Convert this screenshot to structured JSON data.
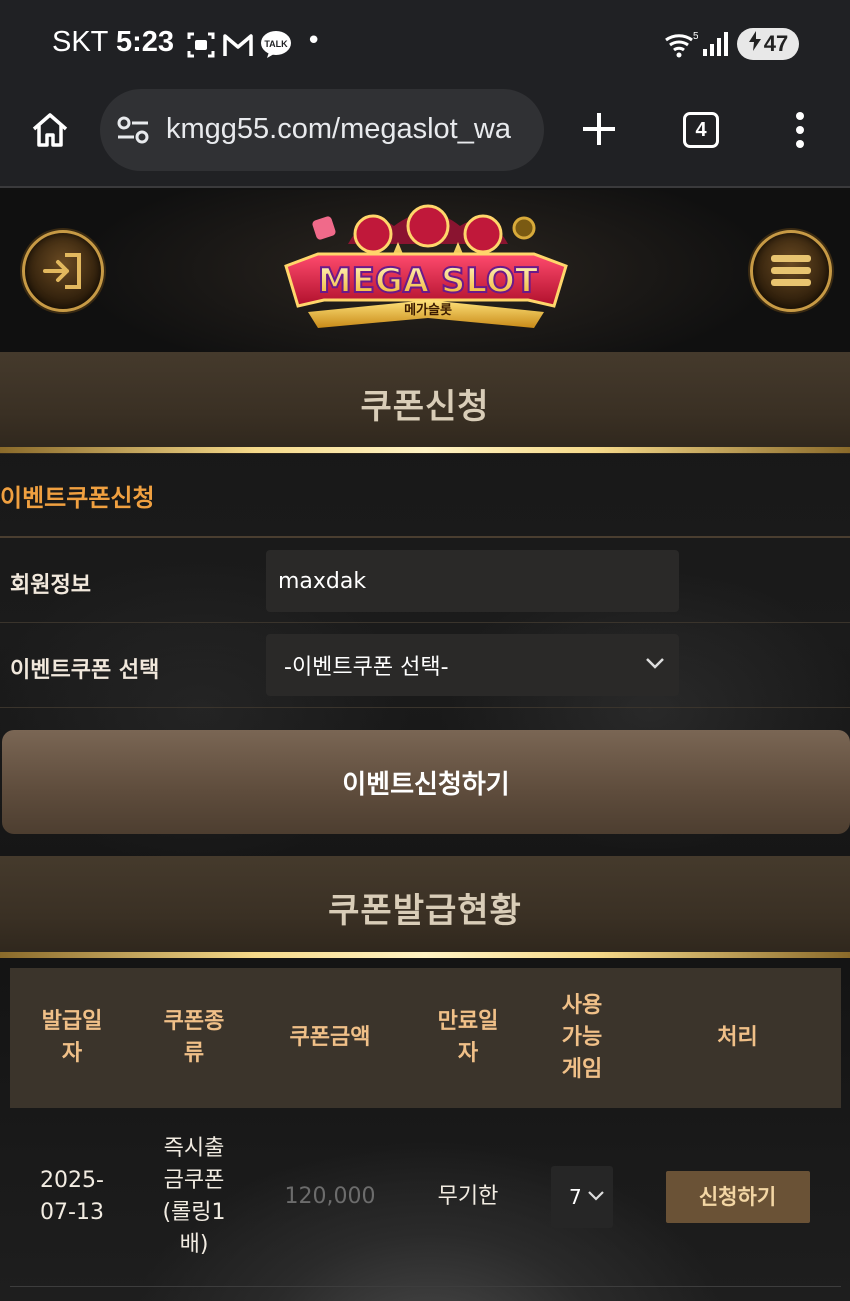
{
  "status_bar": {
    "carrier": "SKT",
    "time": "5:23",
    "kakao_label": "TALK",
    "dot": "•",
    "battery_level": "47"
  },
  "browser": {
    "url": "kmgg55.com/megaslot_wa",
    "tab_count": "4"
  },
  "header": {
    "logo_text": "MEGA SLOT",
    "logo_subtext": "메가슬롯"
  },
  "coupon_apply": {
    "section_title": "쿠폰신청",
    "sub_title": "이벤트쿠폰신청",
    "member_label": "회원정보",
    "member_value": "maxdak",
    "coupon_select_label": "이벤트쿠폰 선택",
    "coupon_select_value": "-이벤트쿠폰 선택-",
    "apply_button": "이벤트신청하기"
  },
  "coupon_status": {
    "section_title": "쿠폰발급현황",
    "headers": {
      "issue_date": "발급일\n자",
      "type": "쿠폰종\n류",
      "amount": "쿠폰금액",
      "expiry": "만료일\n자",
      "games": "사용\n가능\n게임",
      "action": "처리"
    },
    "rows": [
      {
        "issue_date": "2025-\n07-13",
        "type": "즉시출\n금쿠폰\n(롤링1\n배)",
        "amount": "120,000",
        "expiry": "무기한",
        "game_select": "7",
        "action": "신청하기"
      }
    ]
  }
}
